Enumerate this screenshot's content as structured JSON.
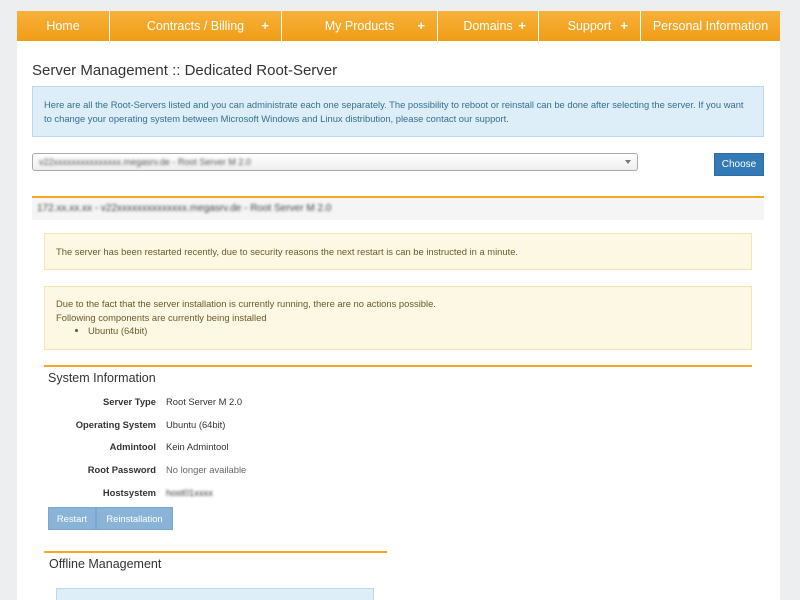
{
  "nav": {
    "items": [
      {
        "label": "Home",
        "has_plus": false
      },
      {
        "label": "Contracts / Billing",
        "has_plus": true
      },
      {
        "label": "My Products",
        "has_plus": true
      },
      {
        "label": "Domains",
        "has_plus": true
      },
      {
        "label": "Support",
        "has_plus": true
      },
      {
        "label": "Personal Information",
        "has_plus": false
      }
    ],
    "plus_symbol": "+"
  },
  "page": {
    "title": "Server Management :: Dedicated Root-Server",
    "info_text": "Here are all the Root-Servers listed and you can administrate each one separately. The possibility to reboot or reinstall can be done after selecting the server. If you want to change your operating system between Microsoft Windows and Linux distribution, please contact our support."
  },
  "server_select": {
    "selected_value": "v22xxxxxxxxxxxxxxx.megasrv.de - Root Server M 2.0",
    "choose_label": "Choose"
  },
  "server": {
    "heading": "172.xx.xx.xx - v22xxxxxxxxxxxxxx.megasrv.de - Root Server M 2.0",
    "restart_notice": "The server has been restarted recently, due to security reasons the next restart is can be instructed in a minute.",
    "install_notice_line1": "Due to the fact that the server installation is currently running, there are no actions possible.",
    "install_notice_line2": "Following components are currently being installed",
    "install_components": [
      "Ubuntu (64bit)"
    ]
  },
  "system_info": {
    "title": "System Information",
    "rows": [
      {
        "label": "Server Type",
        "value": "Root Server M 2.0"
      },
      {
        "label": "Operating System",
        "value": "Ubuntu (64bit)"
      },
      {
        "label": "Admintool",
        "value": "Kein Admintool"
      },
      {
        "label": "Root Password",
        "value": "No longer available"
      },
      {
        "label": "Hostsystem",
        "value": "host01xxxx"
      }
    ],
    "restart_label": "Restart",
    "reinstall_label": "Reinstallation"
  },
  "offline": {
    "title": "Offline Management"
  }
}
